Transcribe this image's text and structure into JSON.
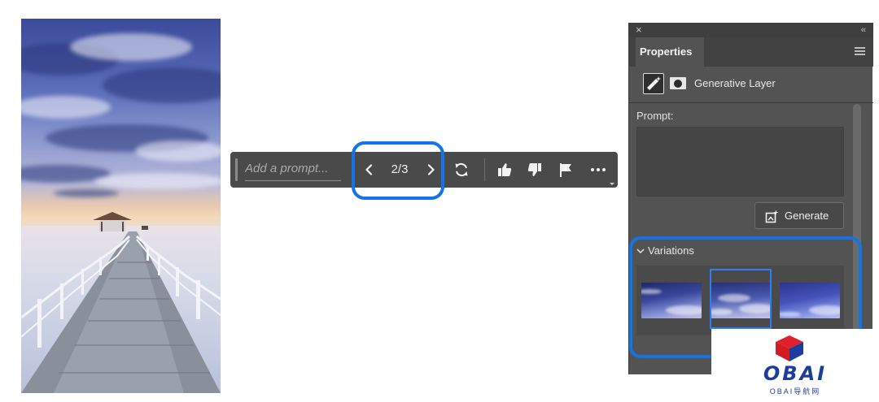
{
  "canvas": {
    "image": "pier photo"
  },
  "task_bar": {
    "prompt_placeholder": "Add a prompt...",
    "variation_counter": "2/3",
    "icons": [
      "drag-handle-icon",
      "chevron-left-icon",
      "chevron-right-icon",
      "regenerate-icon",
      "thumbs-up-icon",
      "thumbs-down-icon",
      "flag-icon",
      "more-icon"
    ]
  },
  "properties_panel": {
    "close_glyph": "×",
    "collapse_glyph": "‹‹",
    "tab_label": "Properties",
    "layer_type": "Generative Layer",
    "prompt_label": "Prompt:",
    "prompt_value": "",
    "generate_label": "Generate",
    "variations_label": "Variations",
    "variation_count": 3,
    "selected_variation": 2
  },
  "highlight_color": "#1473e6",
  "watermark": {
    "title": "OBAI",
    "subtitle": "OBAI导航网"
  }
}
